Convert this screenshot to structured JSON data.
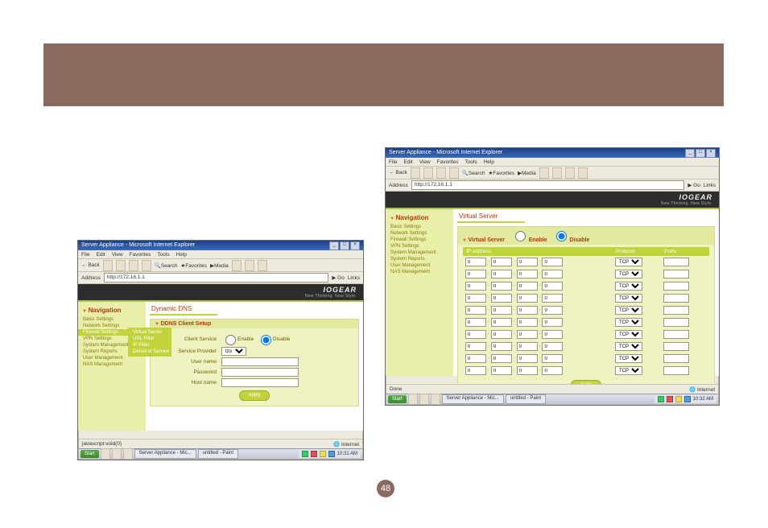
{
  "page_number": "48",
  "common": {
    "window_title": "Server Appliance - Microsoft Internet Explorer",
    "menus": [
      "File",
      "Edit",
      "View",
      "Favorites",
      "Tools",
      "Help"
    ],
    "toolbar": {
      "back": "Back",
      "search": "Search",
      "favorites": "Favorites",
      "media": "Media"
    },
    "address_label": "Address",
    "url": "http://172.16.1.1",
    "go_label": "Go",
    "links_label": "Links",
    "brand": "IOGEAR",
    "tagline": "New Thinking. New Style.",
    "nav_header": "Navigation",
    "nav_items": [
      "Basic Settings",
      "Network Settings",
      "Firewall Settings",
      "VPN Settings",
      "System Management",
      "System Reports",
      "User Management",
      "NAS Management"
    ],
    "status_zone": "Internet",
    "task": {
      "start": "Start",
      "tab1": "Server Appliance - Mic...",
      "tab2": "untitled - Paint"
    }
  },
  "shot1": {
    "page_title": "Dynamic DNS",
    "submenu": [
      "Virtual Server",
      "URL Filter",
      "IP Filter",
      "Denial of Service"
    ],
    "panel_title": "DDNS Client Setup",
    "fields": {
      "client_service_label": "Client Service",
      "enable": "Enable",
      "disable": "Disable",
      "disable_checked": true,
      "service_provider_label": "Service Provider",
      "service_provider_value": "tzo",
      "user_label": "User name",
      "pass_label": "Password",
      "host_label": "Host name",
      "apply": "Apply"
    },
    "status_left": "javascript:void(0)",
    "time": "10:31 AM"
  },
  "shot2": {
    "page_title": "Virtual Server",
    "panel_title": "Virtual Server",
    "enable": "Enable",
    "disable": "Disable",
    "disable_checked": true,
    "columns": {
      "ip": "IP address",
      "protocol": "Protocol",
      "ports": "Ports"
    },
    "row_count": 10,
    "ip_default": "0",
    "protocol_default": "TCP",
    "apply": "Apply",
    "status_left": "Done",
    "time": "10:32 AM"
  }
}
